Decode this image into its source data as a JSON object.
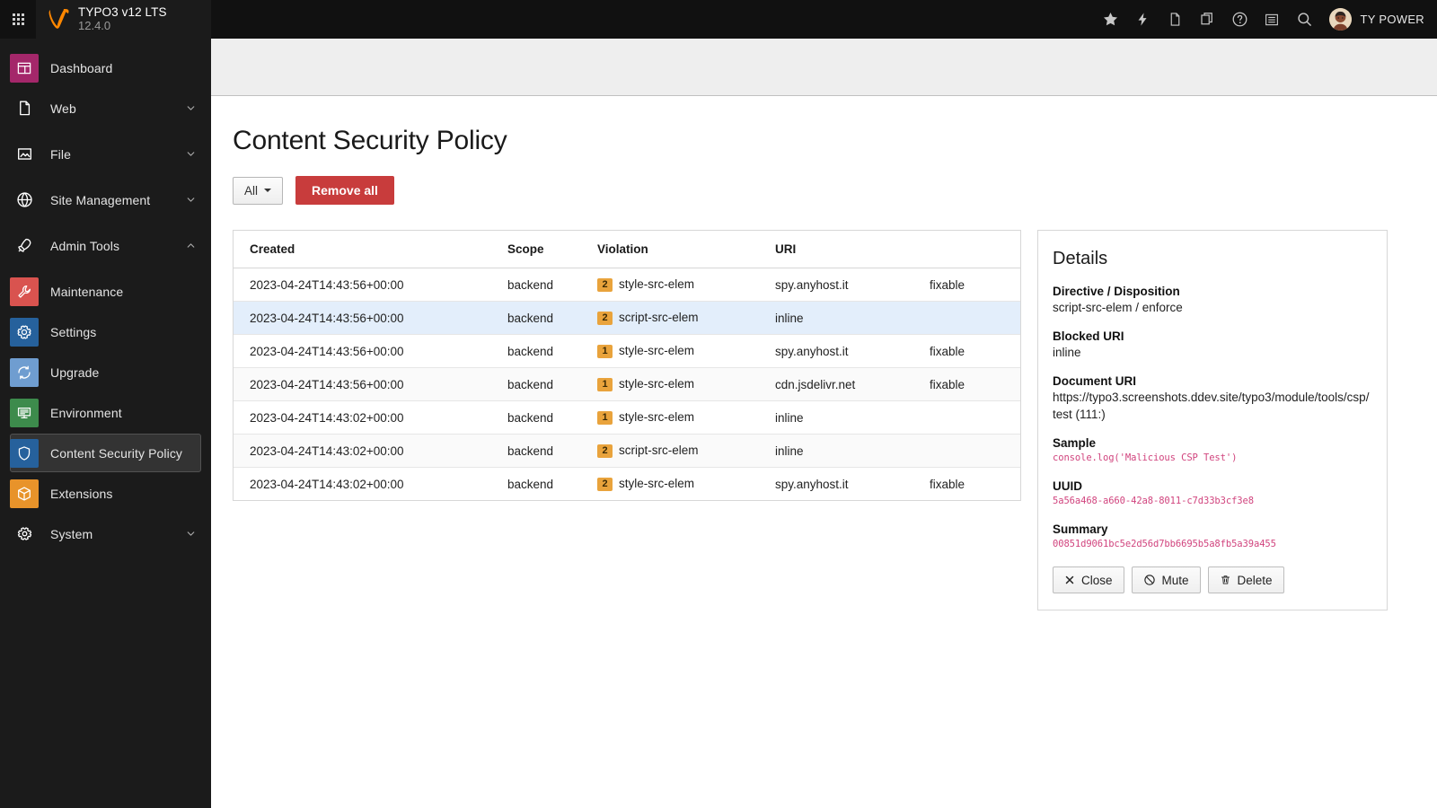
{
  "topbar": {
    "app_grid_icon": "app-grid-icon",
    "logo_icon": "typo3-logo-icon",
    "title": "TYPO3 v12 LTS",
    "version": "12.4.0",
    "icons": [
      {
        "name": "bookmark-star-icon",
        "glyph": "star"
      },
      {
        "name": "flash-clear-cache-icon",
        "glyph": "bolt"
      },
      {
        "name": "new-document-icon",
        "glyph": "document"
      },
      {
        "name": "open-documents-icon",
        "glyph": "copy"
      },
      {
        "name": "help-icon",
        "glyph": "question"
      },
      {
        "name": "list-icon",
        "glyph": "list"
      },
      {
        "name": "search-icon",
        "glyph": "search"
      }
    ],
    "username": "TY POWER"
  },
  "sidebar": {
    "items": [
      {
        "label": "Dashboard",
        "icon": "dashboard-icon",
        "color": "#a4276a",
        "type": "module",
        "expandable": false,
        "active": false
      },
      {
        "label": "Web",
        "icon": "page-icon",
        "color": "transparent",
        "type": "group",
        "expandable": true,
        "expanded": false,
        "active": false
      },
      {
        "label": "File",
        "icon": "image-icon",
        "color": "transparent",
        "type": "group",
        "expandable": true,
        "expanded": false,
        "active": false
      },
      {
        "label": "Site Management",
        "icon": "globe-icon",
        "color": "transparent",
        "type": "group",
        "expandable": true,
        "expanded": false,
        "active": false
      },
      {
        "label": "Admin Tools",
        "icon": "rocket-icon",
        "color": "transparent",
        "type": "group",
        "expandable": true,
        "expanded": true,
        "active": false
      },
      {
        "label": "Maintenance",
        "icon": "wrench-icon",
        "color": "#d9534f",
        "type": "module",
        "expandable": false,
        "active": false
      },
      {
        "label": "Settings",
        "icon": "gear-icon",
        "color": "#26619c",
        "type": "module",
        "expandable": false,
        "active": false
      },
      {
        "label": "Upgrade",
        "icon": "refresh-icon",
        "color": "#6f9dd0",
        "type": "module",
        "expandable": false,
        "active": false
      },
      {
        "label": "Environment",
        "icon": "server-icon",
        "color": "#3d8b4c",
        "type": "module",
        "expandable": false,
        "active": false
      },
      {
        "label": "Content Security Policy",
        "icon": "shield-icon",
        "color": "#26619c",
        "type": "module",
        "expandable": false,
        "active": true
      },
      {
        "label": "Extensions",
        "icon": "box-icon",
        "color": "#e8932a",
        "type": "module",
        "expandable": false,
        "active": false
      },
      {
        "label": "System",
        "icon": "gear-outline-icon",
        "color": "transparent",
        "type": "group",
        "expandable": true,
        "expanded": false,
        "active": false
      }
    ]
  },
  "main": {
    "page_title": "Content Security Policy",
    "toolbar": {
      "scope_filter_label": "All",
      "remove_all_label": "Remove all"
    },
    "table": {
      "columns": [
        "Created",
        "Scope",
        "Violation",
        "URI",
        ""
      ],
      "rows": [
        {
          "created": "2023-04-24T14:43:56+00:00",
          "scope": "backend",
          "count": "2",
          "violation": "style-src-elem",
          "uri": "spy.anyhost.it",
          "flag": "fixable",
          "selected": false
        },
        {
          "created": "2023-04-24T14:43:56+00:00",
          "scope": "backend",
          "count": "2",
          "violation": "script-src-elem",
          "uri": "inline",
          "flag": "",
          "selected": true
        },
        {
          "created": "2023-04-24T14:43:56+00:00",
          "scope": "backend",
          "count": "1",
          "violation": "style-src-elem",
          "uri": "spy.anyhost.it",
          "flag": "fixable",
          "selected": false
        },
        {
          "created": "2023-04-24T14:43:56+00:00",
          "scope": "backend",
          "count": "1",
          "violation": "style-src-elem",
          "uri": "cdn.jsdelivr.net",
          "flag": "fixable",
          "selected": false
        },
        {
          "created": "2023-04-24T14:43:02+00:00",
          "scope": "backend",
          "count": "1",
          "violation": "style-src-elem",
          "uri": "inline",
          "flag": "",
          "selected": false
        },
        {
          "created": "2023-04-24T14:43:02+00:00",
          "scope": "backend",
          "count": "2",
          "violation": "script-src-elem",
          "uri": "inline",
          "flag": "",
          "selected": false
        },
        {
          "created": "2023-04-24T14:43:02+00:00",
          "scope": "backend",
          "count": "2",
          "violation": "style-src-elem",
          "uri": "spy.anyhost.it",
          "flag": "fixable",
          "selected": false
        }
      ]
    },
    "details": {
      "title": "Details",
      "fields": [
        {
          "label": "Directive / Disposition",
          "value": "script-src-elem / enforce",
          "mono": false
        },
        {
          "label": "Blocked URI",
          "value": "inline",
          "mono": false
        },
        {
          "label": "Document URI",
          "value": "https://typo3.screenshots.ddev.site/typo3/module/tools/csp/test (111:)",
          "mono": false
        },
        {
          "label": "Sample",
          "value": "console.log('Malicious CSP Test')",
          "mono": true
        },
        {
          "label": "UUID",
          "value": "5a56a468-a660-42a8-8011-c7d33b3cf3e8",
          "mono": true
        },
        {
          "label": "Summary",
          "value": "00851d9061bc5e2d56d7bb6695b5a8fb5a39a455",
          "mono": true
        }
      ],
      "actions": [
        {
          "label": "Close",
          "icon": "close-icon"
        },
        {
          "label": "Mute",
          "icon": "mute-icon"
        },
        {
          "label": "Delete",
          "icon": "trash-icon"
        }
      ]
    }
  },
  "colors": {
    "accent_orange": "#f49700",
    "danger_red": "#c83c3c",
    "badge_orange": "#e9a33c",
    "selected_row": "#e3eefb",
    "mono_text": "#d1447e"
  }
}
